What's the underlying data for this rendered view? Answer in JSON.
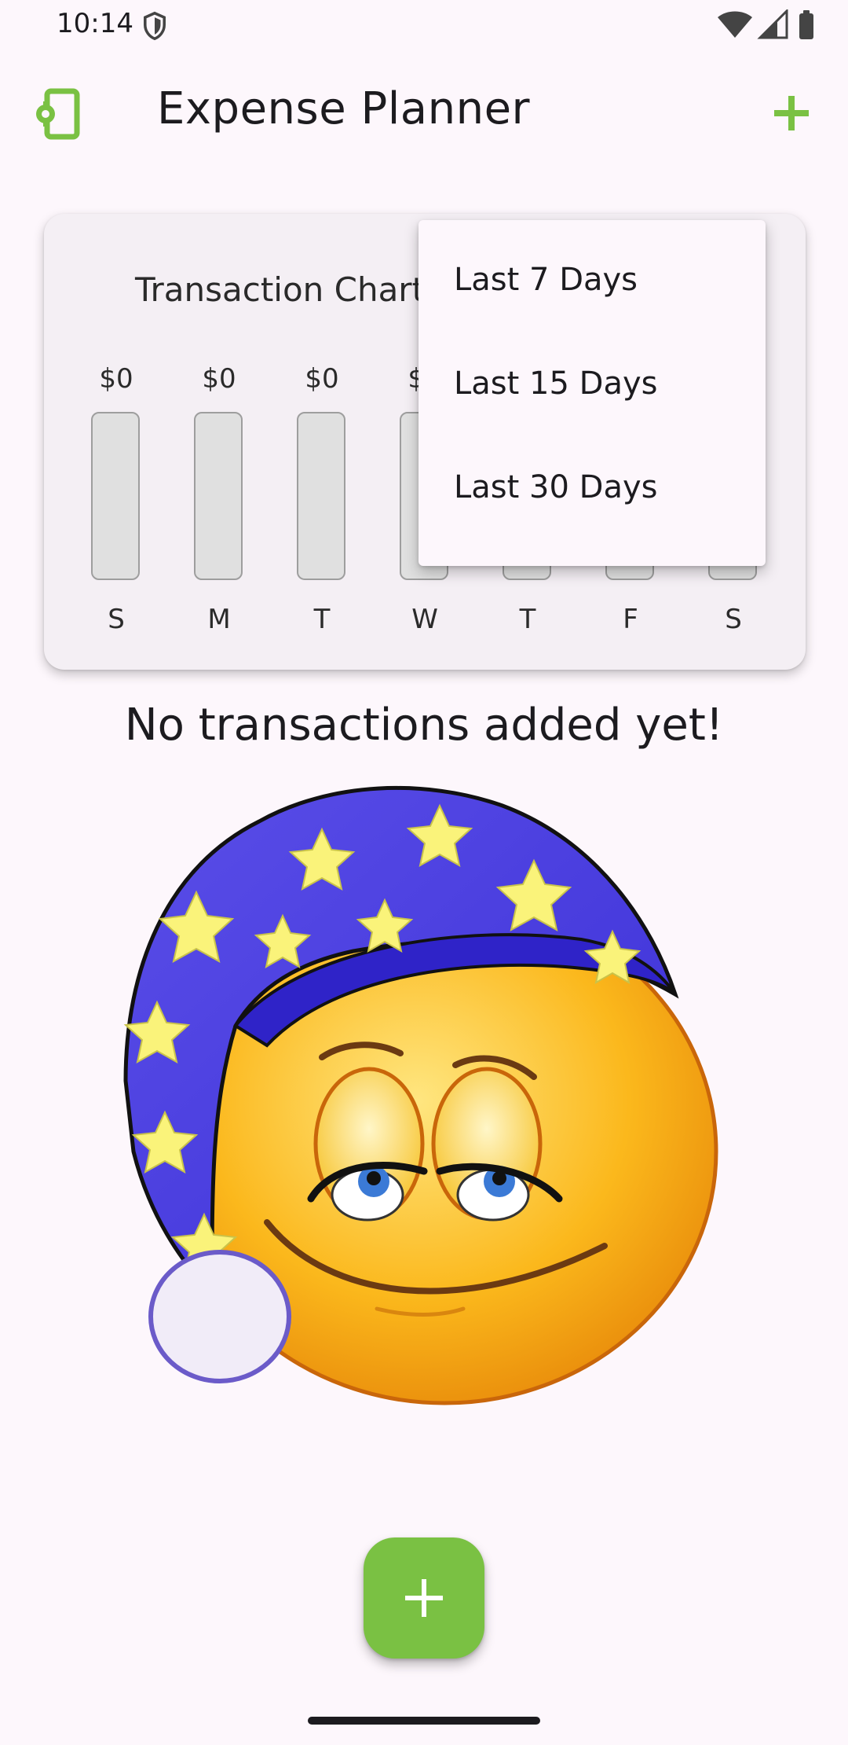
{
  "status_bar": {
    "time": "10:14",
    "icons": [
      "shield-icon",
      "wifi-icon",
      "signal-icon",
      "battery-icon"
    ]
  },
  "app_bar": {
    "title": "Expense Planner",
    "left_icon": "phone-settings-icon",
    "right_icon": "add-icon",
    "accent_color": "#7ac143"
  },
  "chart": {
    "title": "Transaction Chart",
    "bars": [
      {
        "day": "S",
        "value": "$0",
        "fill_fraction": 0
      },
      {
        "day": "M",
        "value": "$0",
        "fill_fraction": 0
      },
      {
        "day": "T",
        "value": "$0",
        "fill_fraction": 0
      },
      {
        "day": "W",
        "value": "$0",
        "fill_fraction": 0
      },
      {
        "day": "T",
        "value": "$0",
        "fill_fraction": 0
      },
      {
        "day": "F",
        "value": "$0",
        "fill_fraction": 0
      },
      {
        "day": "S",
        "value": "$0",
        "fill_fraction": 0
      }
    ]
  },
  "chart_data": {
    "type": "bar",
    "categories": [
      "S",
      "M",
      "T",
      "W",
      "T",
      "F",
      "S"
    ],
    "values": [
      0,
      0,
      0,
      0,
      0,
      0,
      0
    ],
    "title": "Transaction Chart",
    "xlabel": "",
    "ylabel": ""
  },
  "dropdown": {
    "items": [
      "Last 7 Days",
      "Last 15 Days",
      "Last 30 Days"
    ]
  },
  "empty_state": {
    "message": "No transactions added yet!",
    "illustration": "sleeping-emoji-nightcap"
  },
  "fab": {
    "icon": "add-icon",
    "color": "#7ac143"
  }
}
